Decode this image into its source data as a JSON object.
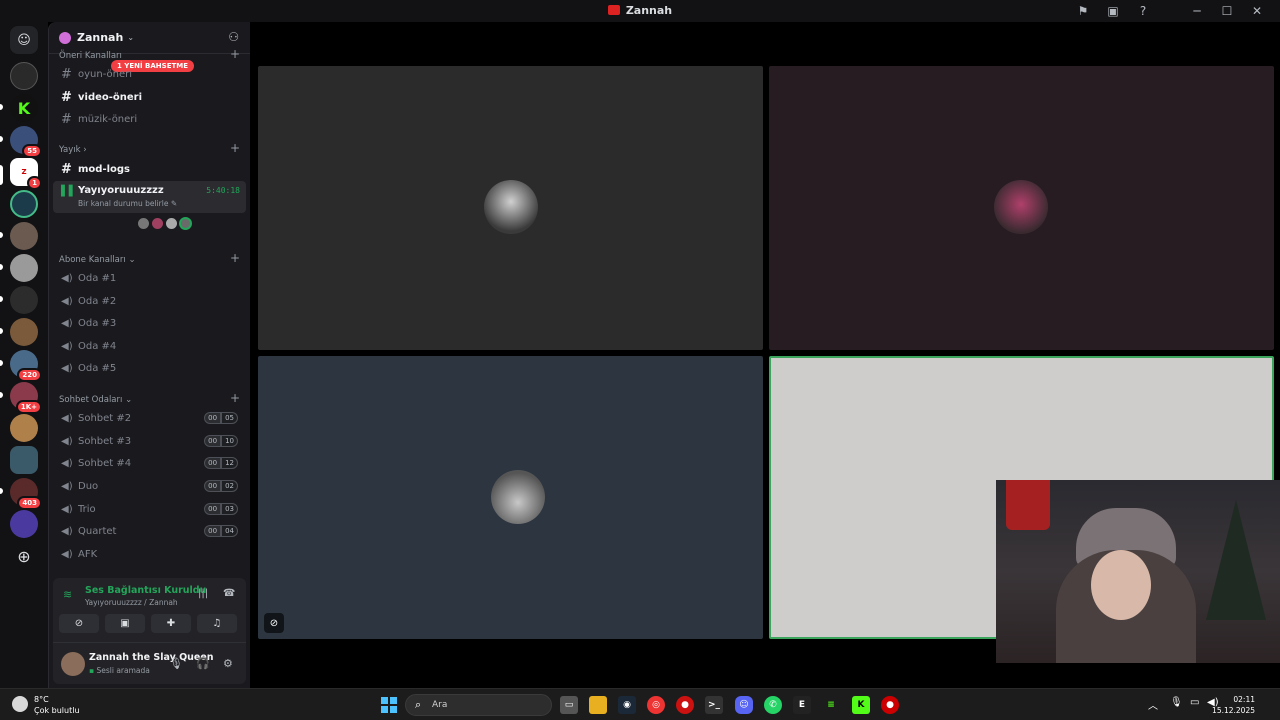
{
  "window": {
    "title": "Zannah"
  },
  "server_rail": {
    "badges": [
      "55",
      "1",
      "220",
      "1K+",
      "403"
    ]
  },
  "guild": {
    "name": "Zannah"
  },
  "channels": {
    "mention_pill": "1 YENİ BAHSETME",
    "top_category": "Öneri Kanalları",
    "text_channels": [
      {
        "name": "oyun-önerı",
        "bold": false
      },
      {
        "name": "video-öneri",
        "bold": true
      },
      {
        "name": "müzik-öneri",
        "bold": false
      }
    ],
    "yayik_category": "Yayık",
    "mod_logs": "mod-logs",
    "active_voice": {
      "name": "Yayıyoruuuzzzz",
      "status": "Bir kanal durumu belirle",
      "timer": "5:40:18"
    },
    "abone_category": "Abone Kanalları",
    "abone_rooms": [
      "Oda #1",
      "Oda #2",
      "Oda #3",
      "Oda #4",
      "Oda #5"
    ],
    "sohbet_category": "Sohbet Odaları",
    "sohbet_rooms": [
      {
        "name": "Sohbet #2",
        "a": "00",
        "b": "05"
      },
      {
        "name": "Sohbet #3",
        "a": "00",
        "b": "10"
      },
      {
        "name": "Sohbet #4",
        "a": "00",
        "b": "12"
      },
      {
        "name": "Duo",
        "a": "00",
        "b": "02"
      },
      {
        "name": "Trio",
        "a": "00",
        "b": "03"
      },
      {
        "name": "Quartet",
        "a": "00",
        "b": "04"
      },
      {
        "name": "AFK",
        "a": "",
        "b": ""
      }
    ]
  },
  "voice_panel": {
    "status": "Ses Bağlantısı Kuruldu",
    "subtitle": "Yayıyoruuuzzzz / Zannah"
  },
  "user_panel": {
    "name": "Zannah the Slay Queen",
    "status": "Sesli aramada"
  },
  "taskbar": {
    "weather_temp": "8°C",
    "weather_desc": "Çok bulutlu",
    "search_placeholder": "Ara",
    "time": "02:11",
    "date": "15.12.2025"
  },
  "colors": {
    "accent_green": "#23a55a",
    "mention_red": "#f23f43",
    "speaking_border": "#3ba55d"
  }
}
